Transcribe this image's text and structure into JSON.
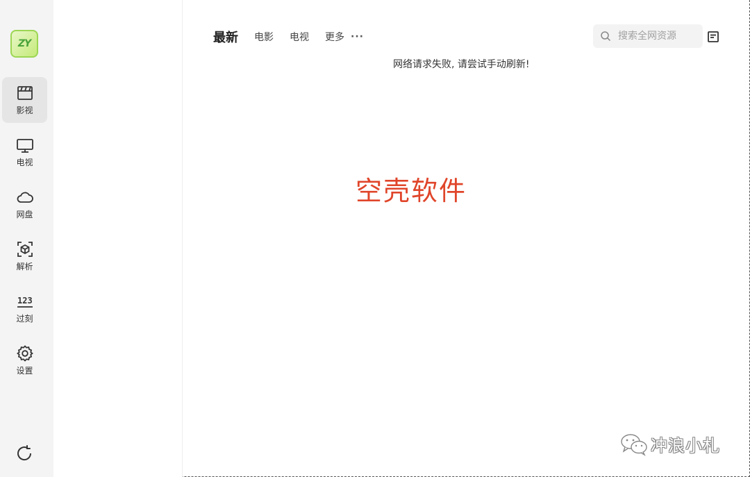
{
  "window": {
    "traffic_lights": [
      "close",
      "minimize",
      "maximize"
    ]
  },
  "sidebar": {
    "logo_text": "ZY",
    "items": [
      {
        "label": "影视",
        "icon": "clapperboard-icon",
        "active": true
      },
      {
        "label": "电视",
        "icon": "tv-icon",
        "active": false
      },
      {
        "label": "网盘",
        "icon": "cloud-icon",
        "active": false
      },
      {
        "label": "解析",
        "icon": "cube-scan-icon",
        "active": false
      },
      {
        "label": "过刻",
        "icon": "numbers-icon",
        "active": false
      },
      {
        "label": "设置",
        "icon": "gear-icon",
        "active": false
      }
    ],
    "bottom_icon": "refresh-icon"
  },
  "tabs": {
    "items": [
      "最新",
      "电影",
      "电视",
      "更多"
    ],
    "active": "最新",
    "more_dots": "···"
  },
  "search": {
    "placeholder": "搜索全网资源",
    "value": ""
  },
  "main": {
    "error_message": "网络请求失败, 请尝试手动刷新!",
    "overlay_text": "空壳软件"
  },
  "watermark": {
    "text": "冲浪小札",
    "icon": "wechat-icon"
  },
  "colors": {
    "overlay_red": "#e0452a",
    "logo_green": "#9cd653",
    "sidebar_bg": "#f4f4f4",
    "active_item_bg": "#e5e5e5"
  }
}
